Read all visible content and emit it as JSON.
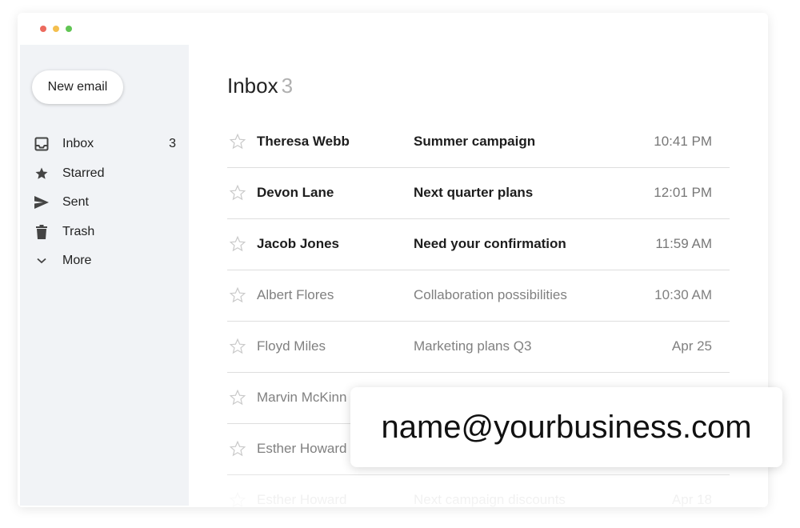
{
  "sidebar": {
    "new_email_label": "New email",
    "items": [
      {
        "label": "Inbox",
        "icon": "inbox-icon",
        "count": "3"
      },
      {
        "label": "Starred",
        "icon": "star-icon",
        "count": ""
      },
      {
        "label": "Sent",
        "icon": "send-icon",
        "count": ""
      },
      {
        "label": "Trash",
        "icon": "trash-icon",
        "count": ""
      },
      {
        "label": "More",
        "icon": "chevron-down-icon",
        "count": ""
      }
    ]
  },
  "main": {
    "title": "Inbox",
    "title_count": "3"
  },
  "emails": [
    {
      "sender": "Theresa Webb",
      "subject": "Summer campaign",
      "time": "10:41 PM",
      "unread": true
    },
    {
      "sender": "Devon Lane",
      "subject": "Next quarter plans",
      "time": "12:01 PM",
      "unread": true
    },
    {
      "sender": "Jacob Jones",
      "subject": "Need your confirmation",
      "time": "11:59 AM",
      "unread": true
    },
    {
      "sender": "Albert Flores",
      "subject": "Collaboration possibilities",
      "time": "10:30 AM",
      "unread": false
    },
    {
      "sender": "Floyd Miles",
      "subject": "Marketing plans Q3",
      "time": "Apr 25",
      "unread": false
    },
    {
      "sender": "Marvin McKinn",
      "subject": "",
      "time": "",
      "unread": false
    },
    {
      "sender": "Esther Howard",
      "subject": "",
      "time": "",
      "unread": false
    },
    {
      "sender": "Esther Howard",
      "subject": "Next campaign discounts",
      "time": "Apr 18",
      "unread": false
    }
  ],
  "email_card": {
    "address": "name@yourbusiness.com"
  },
  "colors": {
    "sidebar_bg": "#f1f3f6",
    "close_dot": "#ec6a5e",
    "minimize_dot": "#f4bf4f",
    "maximize_dot": "#61c554"
  }
}
